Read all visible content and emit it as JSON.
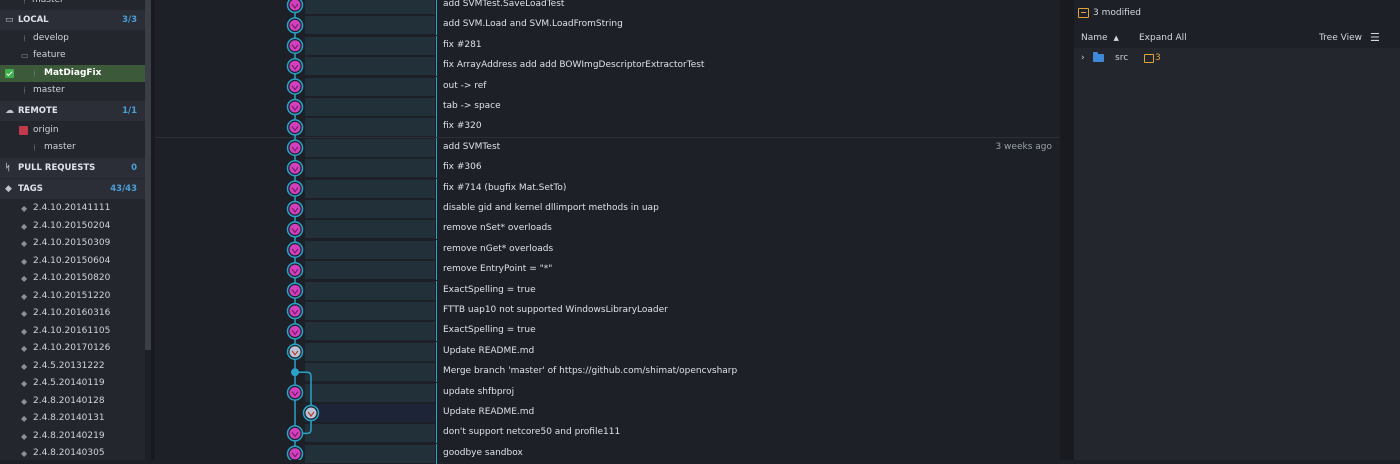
{
  "sidebar": {
    "top_item": "master",
    "local": {
      "title": "LOCAL",
      "count": "3/3",
      "items": [
        {
          "label": "develop",
          "icon": "branch-icon"
        },
        {
          "label": "feature",
          "icon": "folder-icon"
        },
        {
          "label": "MatDiagFix",
          "icon": "branch-icon",
          "selected": true
        },
        {
          "label": "master",
          "icon": "branch-icon"
        }
      ]
    },
    "remote": {
      "title": "REMOTE",
      "count": "1/1",
      "origin": "origin",
      "origin_branch": "master"
    },
    "pull_requests": {
      "title": "PULL REQUESTS",
      "count": "0"
    },
    "tags": {
      "title": "TAGS",
      "count": "43/43",
      "items": [
        "2.4.10.20141111",
        "2.4.10.20150204",
        "2.4.10.20150309",
        "2.4.10.20150604",
        "2.4.10.20150820",
        "2.4.10.20151220",
        "2.4.10.20160316",
        "2.4.10.20161105",
        "2.4.10.20170126",
        "2.4.5.20131222",
        "2.4.5.20140119",
        "2.4.8.20140128",
        "2.4.8.20140131",
        "2.4.8.20140219",
        "2.4.8.20140305"
      ]
    }
  },
  "commits": [
    {
      "message": "add SVMTest.SaveLoadTest"
    },
    {
      "message": "add SVM.Load and SVM.LoadFromString"
    },
    {
      "message": "fix #281"
    },
    {
      "message": "fix ArrayAddress add add BOWImgDescriptorExtractorTest"
    },
    {
      "message": "out -> ref"
    },
    {
      "message": "tab -> space"
    },
    {
      "message": "fix #320"
    },
    {
      "message": "add SVMTest",
      "time": "3 weeks ago"
    },
    {
      "message": "fix #306"
    },
    {
      "message": "fix #714 (bugfix Mat.SetTo)"
    },
    {
      "message": "disable gid and kernel dllimport methods in uap"
    },
    {
      "message": "remove nSet* overloads"
    },
    {
      "message": "remove nGet* overloads"
    },
    {
      "message": "remove EntryPoint = \"*\""
    },
    {
      "message": "ExactSpelling = true"
    },
    {
      "message": "FTTB uap10 not supported WindowsLibraryLoader"
    },
    {
      "message": "ExactSpelling = true"
    },
    {
      "message": "Update README.md"
    },
    {
      "message": "Merge branch 'master' of https://github.com/shimat/opencvsharp"
    },
    {
      "message": "update shfbproj"
    },
    {
      "message": "Update README.md"
    },
    {
      "message": "don't support netcore50 and profile111"
    },
    {
      "message": "goodbye sandbox"
    }
  ],
  "right_panel": {
    "modified_text": "3 modified",
    "name_label": "Name",
    "expand_all": "Expand All",
    "tree_view": "Tree View",
    "folder": "src",
    "folder_count": "3"
  },
  "colors": {
    "accent": "#2ba3c8",
    "avatar": "#d43fbf",
    "selected_branch": "#3c5a3a"
  }
}
